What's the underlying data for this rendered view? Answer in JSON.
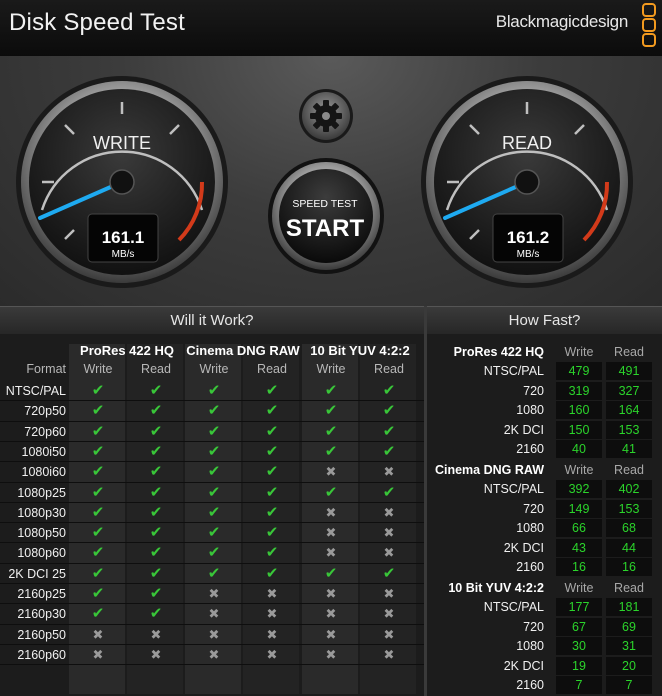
{
  "header": {
    "title": "Disk Speed Test",
    "brand": "Blackmagicdesign",
    "accent_color": "#f29a1f"
  },
  "gauges": {
    "write": {
      "label": "WRITE",
      "value": "161.1",
      "unit": "MB/s",
      "level": 161.1
    },
    "read": {
      "label": "READ",
      "value": "161.2",
      "unit": "MB/s",
      "level": 161.2
    },
    "needle_color": "#1eaaf1"
  },
  "controls": {
    "settings_icon": "gear-icon",
    "start_small": "SPEED TEST",
    "start_big": "START"
  },
  "will_it_work": {
    "title": "Will it Work?",
    "format_header": "Format",
    "groups": [
      "ProRes 422 HQ",
      "Cinema DNG RAW",
      "10 Bit YUV 4:2:2"
    ],
    "sub_headers": [
      "Write",
      "Read",
      "Write",
      "Read",
      "Write",
      "Read"
    ],
    "rows": [
      {
        "format": "NTSC/PAL",
        "cells": [
          1,
          1,
          1,
          1,
          1,
          1
        ]
      },
      {
        "format": "720p50",
        "cells": [
          1,
          1,
          1,
          1,
          1,
          1
        ]
      },
      {
        "format": "720p60",
        "cells": [
          1,
          1,
          1,
          1,
          1,
          1
        ]
      },
      {
        "format": "1080i50",
        "cells": [
          1,
          1,
          1,
          1,
          1,
          1
        ]
      },
      {
        "format": "1080i60",
        "cells": [
          1,
          1,
          1,
          1,
          0,
          0
        ]
      },
      {
        "format": "1080p25",
        "cells": [
          1,
          1,
          1,
          1,
          1,
          1
        ]
      },
      {
        "format": "1080p30",
        "cells": [
          1,
          1,
          1,
          1,
          0,
          0
        ]
      },
      {
        "format": "1080p50",
        "cells": [
          1,
          1,
          1,
          1,
          0,
          0
        ]
      },
      {
        "format": "1080p60",
        "cells": [
          1,
          1,
          1,
          1,
          0,
          0
        ]
      },
      {
        "format": "2K DCI 25",
        "cells": [
          1,
          1,
          1,
          1,
          1,
          1
        ]
      },
      {
        "format": "2160p25",
        "cells": [
          1,
          1,
          0,
          0,
          0,
          0
        ]
      },
      {
        "format": "2160p30",
        "cells": [
          1,
          1,
          0,
          0,
          0,
          0
        ]
      },
      {
        "format": "2160p50",
        "cells": [
          0,
          0,
          0,
          0,
          0,
          0
        ]
      },
      {
        "format": "2160p60",
        "cells": [
          0,
          0,
          0,
          0,
          0,
          0
        ]
      }
    ],
    "ok_glyph": "✔",
    "no_glyph": "✖"
  },
  "how_fast": {
    "title": "How Fast?",
    "write_label": "Write",
    "read_label": "Read",
    "groups": [
      {
        "name": "ProRes 422 HQ",
        "rows": [
          {
            "label": "NTSC/PAL",
            "write": "479",
            "read": "491"
          },
          {
            "label": "720",
            "write": "319",
            "read": "327"
          },
          {
            "label": "1080",
            "write": "160",
            "read": "164"
          },
          {
            "label": "2K DCI",
            "write": "150",
            "read": "153"
          },
          {
            "label": "2160",
            "write": "40",
            "read": "41"
          }
        ]
      },
      {
        "name": "Cinema DNG RAW",
        "rows": [
          {
            "label": "NTSC/PAL",
            "write": "392",
            "read": "402"
          },
          {
            "label": "720",
            "write": "149",
            "read": "153"
          },
          {
            "label": "1080",
            "write": "66",
            "read": "68"
          },
          {
            "label": "2K DCI",
            "write": "43",
            "read": "44"
          },
          {
            "label": "2160",
            "write": "16",
            "read": "16"
          }
        ]
      },
      {
        "name": "10 Bit YUV 4:2:2",
        "rows": [
          {
            "label": "NTSC/PAL",
            "write": "177",
            "read": "181"
          },
          {
            "label": "720",
            "write": "67",
            "read": "69"
          },
          {
            "label": "1080",
            "write": "30",
            "read": "31"
          },
          {
            "label": "2K DCI",
            "write": "19",
            "read": "20"
          },
          {
            "label": "2160",
            "write": "7",
            "read": "7"
          }
        ]
      }
    ]
  }
}
